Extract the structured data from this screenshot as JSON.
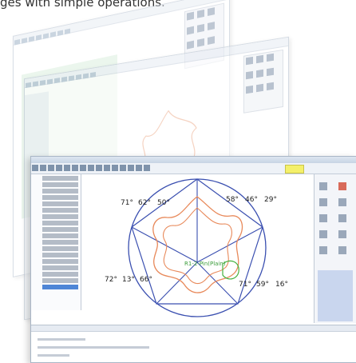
{
  "caption": "ges with simple operations.",
  "main_window": {
    "angles": [
      {
        "text": "71°"
      },
      {
        "text": "62°"
      },
      {
        "text": "50°"
      },
      {
        "text": "58°"
      },
      {
        "text": "46°"
      },
      {
        "text": "29°"
      },
      {
        "text": "72°"
      },
      {
        "text": "13°"
      },
      {
        "text": "66°"
      },
      {
        "text": "71°"
      },
      {
        "text": "59°"
      },
      {
        "text": "16°"
      }
    ],
    "green_label": "R1-2-Pin(Plain)"
  },
  "colors": {
    "circle_and_lines": "#3a4fb0",
    "pattern_outline": "#e8895a",
    "green_shape": "#45b23e",
    "toolbar_highlight": "#f4f06a"
  }
}
